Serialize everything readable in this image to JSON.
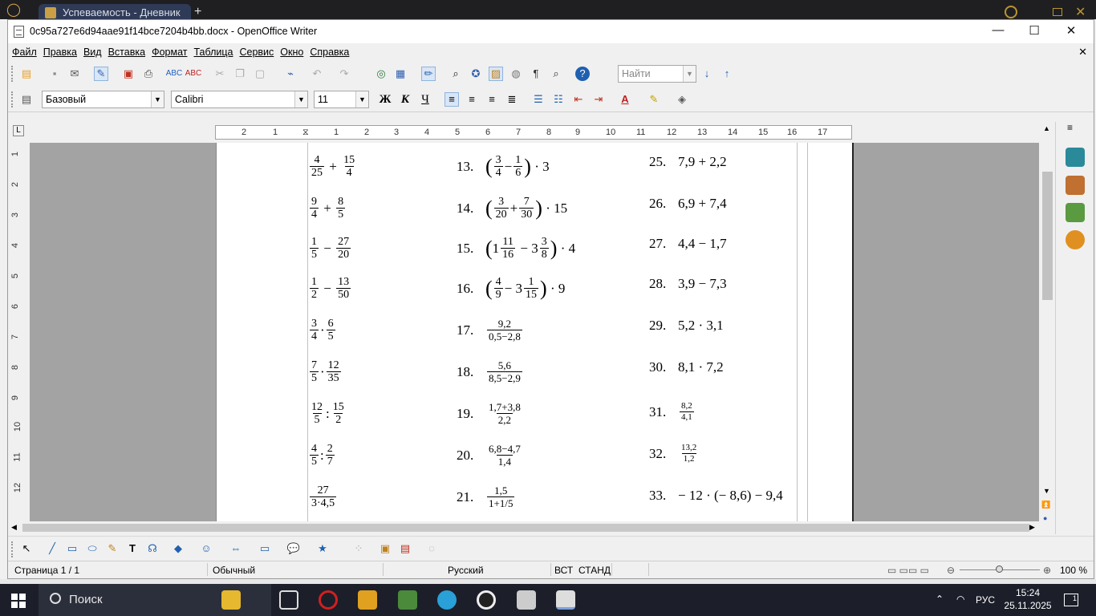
{
  "browser": {
    "tab_title": "Успеваемость - Дневник",
    "new_tab": "+"
  },
  "window": {
    "title": "0c95a727e6d94aae91f14bce7204b4bb.docx - OpenOffice Writer",
    "minimize": "—",
    "maximize": "☐",
    "close": "✕"
  },
  "menubar": {
    "items": [
      "Файл",
      "Правка",
      "Вид",
      "Вставка",
      "Формат",
      "Таблица",
      "Сервис",
      "Окно",
      "Справка"
    ],
    "close": "✕"
  },
  "toolbar": {
    "find_placeholder": "Найти"
  },
  "format": {
    "style": "Базовый",
    "font": "Calibri",
    "size": "11",
    "bold": "Ж",
    "italic": "К",
    "underline": "Ч"
  },
  "ruler": {
    "h_ticks": [
      "2",
      "1",
      "1",
      "2",
      "3",
      "4",
      "5",
      "6",
      "7",
      "8",
      "9",
      "10",
      "11",
      "12",
      "13",
      "14",
      "15",
      "16",
      "17"
    ],
    "v_ticks": [
      "1",
      "2",
      "3",
      "4",
      "5",
      "6",
      "7",
      "8",
      "9",
      "10",
      "11",
      "12"
    ]
  },
  "document": {
    "col1": [
      {
        "a": "4",
        "b": "25",
        "op": "+",
        "c": "15",
        "d": "4"
      },
      {
        "a": "9",
        "b": "4",
        "op": "+",
        "c": "8",
        "d": "5"
      },
      {
        "a": "1",
        "b": "5",
        "op": "−",
        "c": "27",
        "d": "20"
      },
      {
        "a": "1",
        "b": "2",
        "op": "−",
        "c": "13",
        "d": "50"
      },
      {
        "a": "3",
        "b": "4",
        "op": "·",
        "c": "6",
        "d": "5"
      },
      {
        "a": "7",
        "b": "5",
        "op": "·",
        "c": "12",
        "d": "35"
      },
      {
        "a": "12",
        "b": "5",
        "op": ":",
        "c": "15",
        "d": "2"
      },
      {
        "a": "4",
        "b": "5",
        "op": ":",
        "c": "2",
        "d": "7"
      },
      {
        "single_num": "27",
        "single_den": "3·4,5"
      }
    ],
    "col2": [
      {
        "n": "13.",
        "text": "(3/4 − 1/6) · 3"
      },
      {
        "n": "14.",
        "text": "(3/20 + 7/30) · 15"
      },
      {
        "n": "15.",
        "text": "(1 11/16 − 3 3/8) · 4"
      },
      {
        "n": "16.",
        "text": "(4/9 − 3 1/15) · 9"
      },
      {
        "n": "17.",
        "num": "9,2",
        "den": "0,5−2,8"
      },
      {
        "n": "18.",
        "num": "5,6",
        "den": "8,5−2,9"
      },
      {
        "n": "19.",
        "num": "1,7+3,8",
        "den": "2,2"
      },
      {
        "n": "20.",
        "num": "6,8−4,7",
        "den": "1,4"
      },
      {
        "n": "21.",
        "num": "1,5",
        "den": "1+1/5"
      }
    ],
    "col2_parts": {
      "p13": {
        "a": "3",
        "b": "4",
        "op": "−",
        "c": "1",
        "d": "6",
        "tail": "· 3"
      },
      "p14": {
        "a": "3",
        "b": "20",
        "op": "+",
        "c": "7",
        "d": "30",
        "tail": "· 15"
      },
      "p15": {
        "w1": "1",
        "a": "11",
        "b": "16",
        "op": "−",
        "w2": "3",
        "c": "3",
        "d": "8",
        "tail": "· 4"
      },
      "p16": {
        "a": "4",
        "b": "9",
        "op": "−",
        "w2": "3",
        "c": "1",
        "d": "15",
        "tail": "· 9"
      }
    },
    "col3": [
      {
        "n": "25.",
        "text": "7,9 + 2,2"
      },
      {
        "n": "26.",
        "text": "6,9 + 7,4"
      },
      {
        "n": "27.",
        "text": "4,4 − 1,7"
      },
      {
        "n": "28.",
        "text": "3,9 − 7,3"
      },
      {
        "n": "29.",
        "text": "5,2 · 3,1"
      },
      {
        "n": "30.",
        "text": "8,1 · 7,2"
      },
      {
        "n": "31.",
        "num": "8,2",
        "den": "4,1"
      },
      {
        "n": "32.",
        "num": "13,2",
        "den": "1,2"
      },
      {
        "n": "33.",
        "text": "− 12 · (− 8,6) − 9,4"
      }
    ]
  },
  "status": {
    "page": "Страница  1 / 1",
    "style": "Обычный",
    "lang": "Русский",
    "ins": "ВСТ",
    "sel": "СТАНД",
    "zoom": "100 %"
  },
  "taskbar": {
    "search": "Поиск",
    "lang": "РУС",
    "time": "15:24",
    "date": "25.11.2025",
    "notif": "1"
  }
}
